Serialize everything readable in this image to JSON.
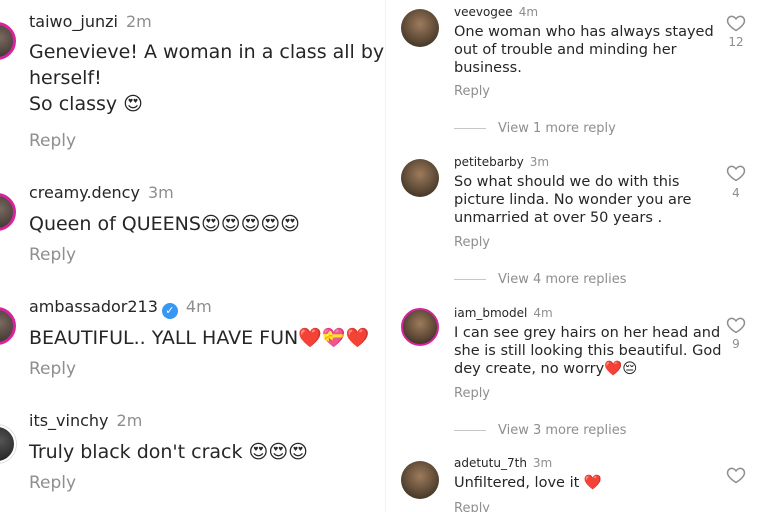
{
  "left_comments": [
    {
      "username": "taiwo_junzi",
      "time": "2m",
      "lines": [
        "Genevieve! A woman in a class all by",
        "herself!",
        "So classy 😍"
      ],
      "reply": "Reply"
    },
    {
      "username": "creamy.dency",
      "time": "3m",
      "lines": [
        "Queen of QUEENS😍😍😍😍😍"
      ],
      "reply": "Reply"
    },
    {
      "username": "ambassador213",
      "verified": true,
      "time": "4m",
      "lines": [
        "BEAUTIFUL.. YALL HAVE FUN❤️💝❤️"
      ],
      "reply": "Reply"
    },
    {
      "username": "its_vinchy",
      "time": "2m",
      "lines": [
        "Truly black don't crack 😍😍😍"
      ],
      "reply": "Reply"
    }
  ],
  "right_comments": [
    {
      "username": "veevogee",
      "time": "4m",
      "text": "One woman who has always stayed out of trouble and minding her business.",
      "reply": "Reply",
      "likes": "12"
    },
    {
      "username": "petitebarby",
      "time": "3m",
      "text": "So what should we do with this picture linda.  No wonder you are unmarried at over 50 years .",
      "reply": "Reply",
      "likes": "4"
    },
    {
      "username": "iam_bmodel",
      "time": "4m",
      "text": "I can see grey hairs on her head and she is still looking this beautiful. God dey create, no worry❤️😔",
      "reply": "Reply",
      "likes": "9"
    },
    {
      "username": "adetutu_7th",
      "time": "3m",
      "text": "Unfiltered,  love it ❤️",
      "reply": "Reply",
      "likes": ""
    }
  ],
  "view_more": [
    "View 1 more reply",
    "View 4 more replies",
    "View 3 more replies"
  ],
  "icons": {
    "like": "heart-outline-icon",
    "verified": "verified-badge-icon"
  },
  "colors": {
    "text": "#262626",
    "muted": "#8e8e8e",
    "verified": "#3897f0",
    "story_ring": "#d6249f"
  }
}
